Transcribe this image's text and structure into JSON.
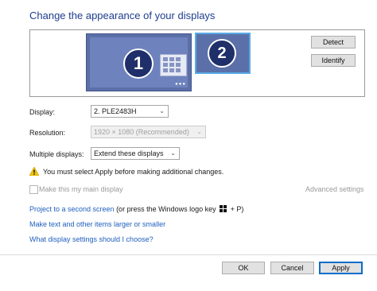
{
  "header": {
    "title": "Change the appearance of your displays"
  },
  "preview": {
    "monitor1": {
      "number": "1"
    },
    "monitor2": {
      "number": "2"
    },
    "detect_label": "Detect",
    "identify_label": "Identify"
  },
  "settings": {
    "display_label": "Display:",
    "display_value": "2. PLE2483H",
    "resolution_label": "Resolution:",
    "resolution_value": "1920 × 1080 (Recommended)",
    "multiple_label": "Multiple displays:",
    "multiple_value": "Extend these displays",
    "warning_text": "You must select Apply before making additional changes.",
    "main_display_label": "Make this my main display",
    "advanced_label": "Advanced settings"
  },
  "links": {
    "project_text": "Project to a second screen",
    "project_suffix_pre": " (or press the Windows logo key ",
    "project_suffix_post": " + P)",
    "text_size": "Make text and other items larger or smaller",
    "which_settings": "What display settings should I choose?"
  },
  "footer": {
    "ok_label": "OK",
    "cancel_label": "Cancel",
    "apply_label": "Apply"
  },
  "colors": {
    "title": "#1e3d8f",
    "link": "#1f5fbf",
    "monitor": "#5b70a8",
    "selected_border": "#5aa9e6",
    "apply_border": "#0a6ccc",
    "warning": "#f2c200"
  },
  "icons": [
    "warning-icon",
    "windows-logo-icon",
    "chevron-down-icon",
    "start-grid-icon"
  ]
}
